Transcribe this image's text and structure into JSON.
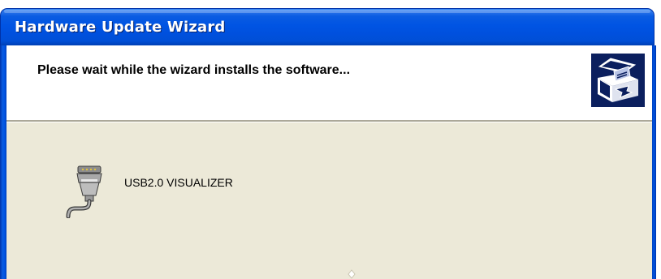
{
  "window": {
    "title": "Hardware Update Wizard"
  },
  "header": {
    "heading": "Please wait while the wizard installs the software...",
    "icon": "hardware-wizard-icon"
  },
  "body": {
    "device_name": "USB2.0 VISUALIZER",
    "device_icon": "serial-plug-icon"
  },
  "colors": {
    "titlebar": "#0054e3",
    "body_background": "#ece9d8",
    "header_background": "#ffffff"
  }
}
